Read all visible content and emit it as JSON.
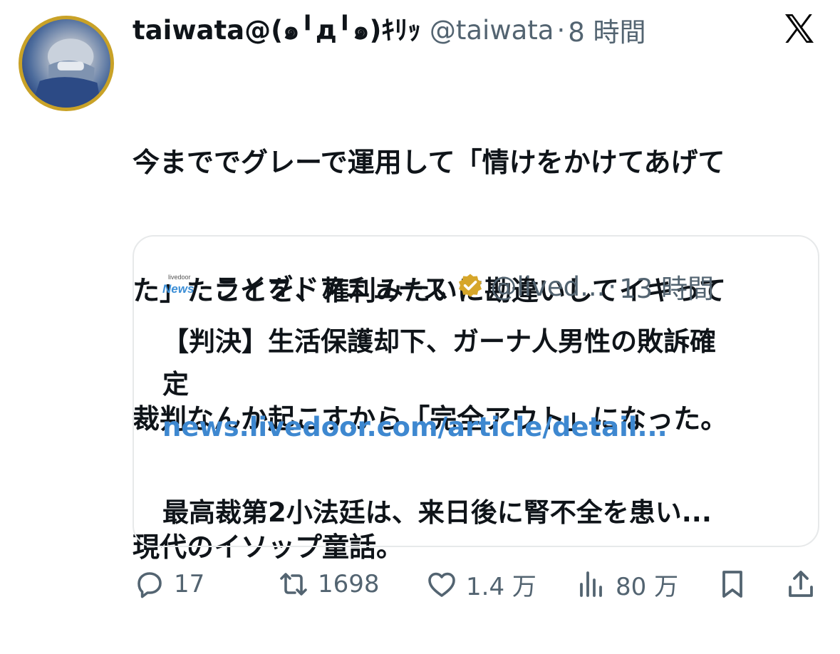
{
  "tweet": {
    "display_name": "taiwata@(๑╹д╹๑)ｷﾘｯ",
    "handle": "@taiwata",
    "separator": "·",
    "time": "8 時間",
    "text_lines": [
      "今まででグレーで運用して「情けをかけてあげて",
      "た」たことを、権利みたいに勘違いしてイキって",
      "裁判なんか起こすから「完全アウト」になった。",
      "現代のイソップ童話。"
    ]
  },
  "quote": {
    "logo_small": "livedoor",
    "logo_big": "News",
    "name": "ライブドアニュース",
    "handle": "@lived...",
    "separator": "·",
    "time": "13 時間",
    "lines": [
      "【判決】生活保護却下、ガーナ人男性の敗訴確",
      "定",
      "news.livedoor.com/article/detail...",
      "",
      "最高裁第2小法廷は、来日後に腎不全を患い..."
    ]
  },
  "actions": {
    "reply_count": "17",
    "retweet_count": "1698",
    "like_count": "1.4 万",
    "views_count": "80 万"
  },
  "icons": {
    "brand": "x-logo",
    "verified": "verified-badge-icon",
    "reply": "reply-icon",
    "retweet": "retweet-icon",
    "like": "heart-icon",
    "views": "views-icon",
    "bookmark": "bookmark-icon",
    "share": "share-icon"
  },
  "colors": {
    "text": "#0f1419",
    "muted": "#536471",
    "link": "#3e88d0",
    "border": "#e7e9ea",
    "verified_gold": "#d6a62a"
  }
}
